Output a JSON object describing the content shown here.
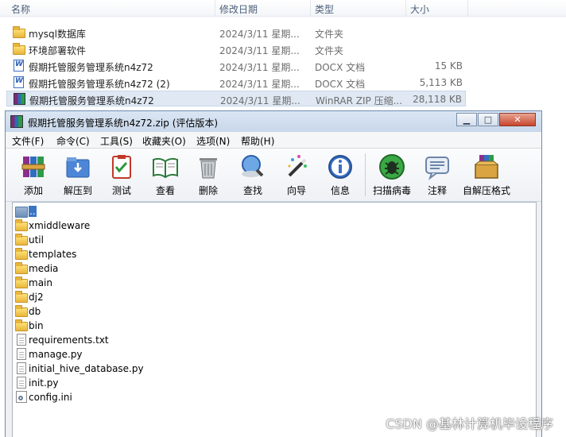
{
  "explorer": {
    "columns": {
      "name": "名称",
      "date": "修改日期",
      "type": "类型",
      "size": "大小"
    },
    "rows": [
      {
        "icon": "folder-icon",
        "name": "mysql数据库",
        "date": "2024/3/11 星期...",
        "type": "文件夹",
        "size": ""
      },
      {
        "icon": "folder-icon",
        "name": "环境部署软件",
        "date": "2024/3/11 星期...",
        "type": "文件夹",
        "size": ""
      },
      {
        "icon": "docx-icon",
        "name": "假期托管服务管理系统n4z72",
        "date": "2024/3/11 星期...",
        "type": "DOCX 文档",
        "size": "15 KB"
      },
      {
        "icon": "docx-icon",
        "name": "假期托管服务管理系统n4z72 (2)",
        "date": "2024/3/11 星期...",
        "type": "DOCX 文档",
        "size": "5,113 KB"
      },
      {
        "icon": "winrar-icon",
        "name": "假期托管服务管理系统n4z72",
        "date": "2024/3/11 星期...",
        "type": "WinRAR ZIP 压缩...",
        "size": "28,118 KB",
        "selected": true
      }
    ]
  },
  "winrar": {
    "title": "假期托管服务管理系统n4z72.zip (评估版本)",
    "window_buttons": {
      "minimize": "▁",
      "maximize": "□",
      "close": "✕"
    },
    "menu": [
      "文件(F)",
      "命令(C)",
      "工具(S)",
      "收藏夹(O)",
      "选项(N)",
      "帮助(H)"
    ],
    "toolbar": [
      {
        "label": "添加",
        "icon": "add-archive-icon"
      },
      {
        "label": "解压到",
        "icon": "extract-to-icon"
      },
      {
        "label": "测试",
        "icon": "test-icon"
      },
      {
        "label": "查看",
        "icon": "view-book-icon"
      },
      {
        "label": "删除",
        "icon": "trash-icon"
      },
      {
        "label": "查找",
        "icon": "magnifier-icon"
      },
      {
        "label": "向导",
        "icon": "wizard-wand-icon"
      },
      {
        "label": "信息",
        "icon": "info-icon"
      },
      {
        "label": "扫描病毒",
        "icon": "virus-scan-icon"
      },
      {
        "label": "注释",
        "icon": "comment-icon"
      },
      {
        "label": "自解压格式",
        "icon": "sfx-box-icon"
      }
    ],
    "files": [
      {
        "name": "..",
        "icon": "up-folder-icon"
      },
      {
        "name": "xmiddleware",
        "icon": "folder-icon"
      },
      {
        "name": "util",
        "icon": "folder-icon"
      },
      {
        "name": "templates",
        "icon": "folder-icon"
      },
      {
        "name": "media",
        "icon": "folder-icon"
      },
      {
        "name": "main",
        "icon": "folder-icon"
      },
      {
        "name": "dj2",
        "icon": "folder-icon"
      },
      {
        "name": "db",
        "icon": "folder-icon"
      },
      {
        "name": "bin",
        "icon": "folder-icon"
      },
      {
        "name": "requirements.txt",
        "icon": "text-file-icon"
      },
      {
        "name": "manage.py",
        "icon": "text-file-icon"
      },
      {
        "name": "initial_hive_database.py",
        "icon": "text-file-icon"
      },
      {
        "name": "init.py",
        "icon": "text-file-icon"
      },
      {
        "name": "config.ini",
        "icon": "config-file-icon"
      }
    ]
  },
  "watermark": "CSDN @基林计算机毕设程序",
  "colors": {
    "selection": "#3c74c4",
    "row_selected": "#dfe8f3",
    "title_bar": "#c8d7ea"
  }
}
